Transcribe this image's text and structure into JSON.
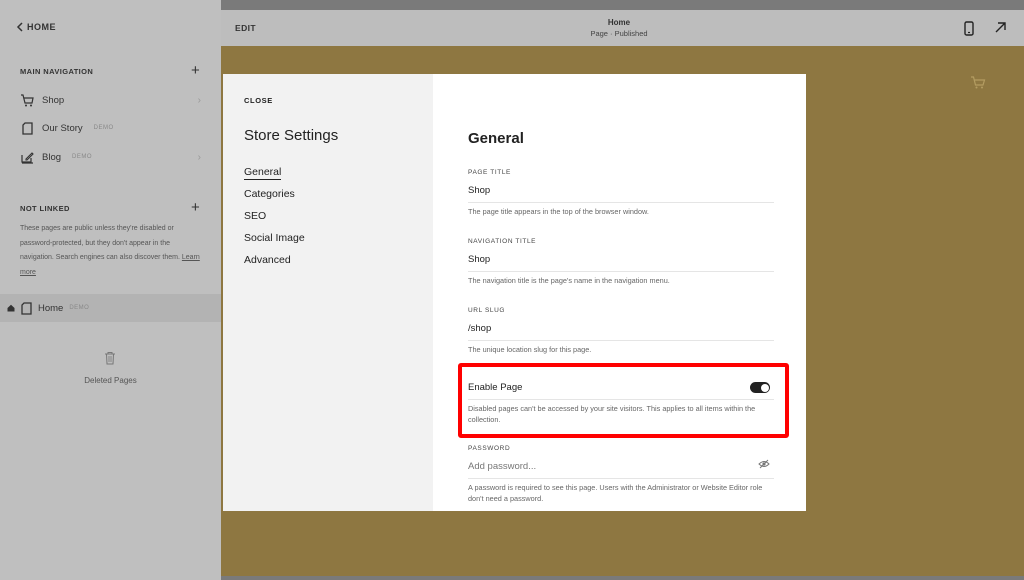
{
  "sidebar": {
    "home_label": "HOME",
    "main_nav_title": "MAIN NAVIGATION",
    "items": [
      {
        "label": "Shop",
        "badge": ""
      },
      {
        "label": "Our Story",
        "badge": "DEMO"
      },
      {
        "label": "Blog",
        "badge": "DEMO"
      }
    ],
    "not_linked_title": "NOT LINKED",
    "not_linked_note": "These pages are public unless they're disabled or password-protected, but they don't appear in the navigation. Search engines can also discover them.",
    "learn_more": "Learn more",
    "home_page": {
      "label": "Home",
      "badge": "DEMO"
    },
    "deleted_pages": "Deleted Pages"
  },
  "topbar": {
    "edit_label": "EDIT",
    "page_title": "Home",
    "page_status": "Page · Published"
  },
  "modal": {
    "close_label": "CLOSE",
    "title": "Store Settings",
    "nav": [
      "General",
      "Categories",
      "SEO",
      "Social Image",
      "Advanced"
    ],
    "active_nav": "General",
    "heading": "General",
    "fields": {
      "page_title": {
        "label": "PAGE TITLE",
        "value": "Shop",
        "help": "The page title appears in the top of the browser window."
      },
      "nav_title": {
        "label": "NAVIGATION TITLE",
        "value": "Shop",
        "help": "The navigation title is the page's name in the navigation menu."
      },
      "url_slug": {
        "label": "URL SLUG",
        "value": "/shop",
        "help": "The unique location slug for this page."
      },
      "enable_page": {
        "label": "Enable Page",
        "enabled": true,
        "help": "Disabled pages can't be accessed by your site visitors. This applies to all items within the collection."
      },
      "password": {
        "label": "PASSWORD",
        "placeholder": "Add password...",
        "help": "A password is required to see this page. Users with the Administrator or Website Editor role don't need a password."
      }
    }
  },
  "colors": {
    "highlight": "#ff0000",
    "canvas": "#8e7741"
  }
}
